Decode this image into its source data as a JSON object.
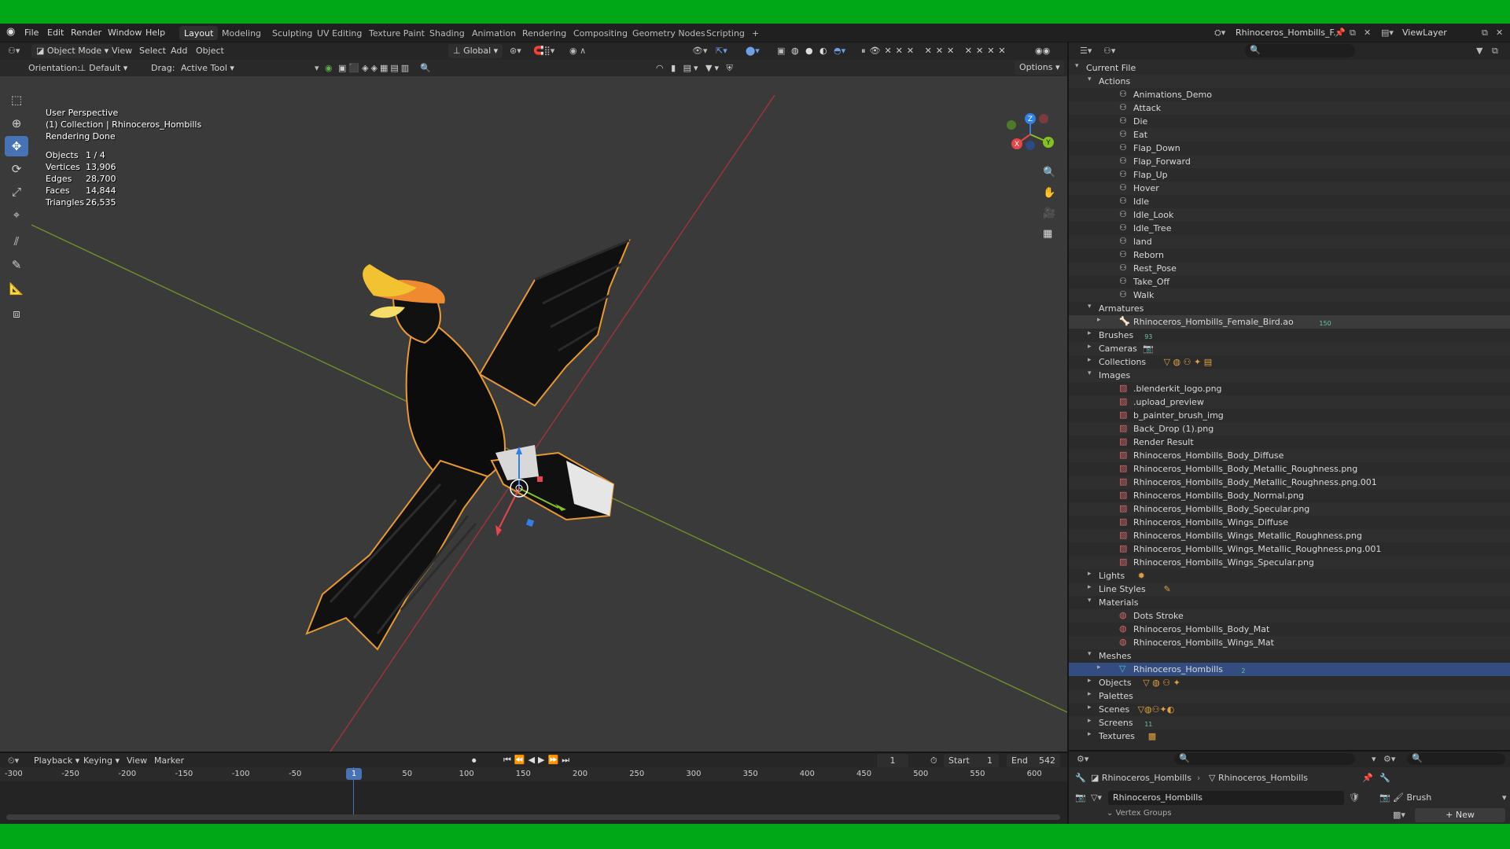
{
  "topbar": {
    "menus": [
      "File",
      "Edit",
      "Render",
      "Window",
      "Help"
    ],
    "workspaces": [
      "Layout",
      "Modeling",
      "Sculpting",
      "UV Editing",
      "Texture Paint",
      "Shading",
      "Animation",
      "Rendering",
      "Compositing",
      "Geometry Nodes",
      "Scripting"
    ],
    "active_workspace": "Layout",
    "add_workspace": "+",
    "scene_name": "Rhinoceros_Hombills_F...",
    "view_layer": "ViewLayer"
  },
  "viewport_header": {
    "mode": "Object Mode",
    "menus": [
      "View",
      "Select",
      "Add",
      "Object"
    ],
    "transform_orientation": "Global",
    "orientation_label": "Orientation:",
    "orientation_value": "Default",
    "drag_label": "Drag:",
    "drag_value": "Active Tool",
    "options": "Options"
  },
  "viewport_overlay": {
    "perspective": "User Perspective",
    "collection": "(1) Collection | Rhinoceros_Hombills",
    "status": "Rendering Done",
    "stats": [
      {
        "label": "Objects",
        "value": "1 / 4"
      },
      {
        "label": "Vertices",
        "value": "13,906"
      },
      {
        "label": "Edges",
        "value": "28,700"
      },
      {
        "label": "Faces",
        "value": "14,844"
      },
      {
        "label": "Triangles",
        "value": "26,535"
      }
    ],
    "gizmo_axes": {
      "x": "X",
      "y": "Y",
      "z": "Z"
    }
  },
  "outliner": {
    "root": "Current File",
    "actions_label": "Actions",
    "actions": [
      "Animations_Demo",
      "Attack",
      "Die",
      "Eat",
      "Flap_Down",
      "Flap_Forward",
      "Flap_Up",
      "Hover",
      "Idle",
      "Idle_Look",
      "Idle_Tree",
      "land",
      "Reborn",
      "Rest_Pose",
      "Take_Off",
      "Walk"
    ],
    "armatures_label": "Armatures",
    "armature_item": "Rhinoceros_Hombills_Female_Bird.ao",
    "armature_count": "150",
    "brushes_label": "Brushes",
    "brushes_count": "93",
    "cameras_label": "Cameras",
    "collections_label": "Collections",
    "images_label": "Images",
    "images": [
      ".blenderkit_logo.png",
      ".upload_preview",
      "b_painter_brush_img",
      "Back_Drop (1).png",
      "Render Result",
      "Rhinoceros_Hombills_Body_Diffuse",
      "Rhinoceros_Hombills_Body_Metallic_Roughness.png",
      "Rhinoceros_Hombills_Body_Metallic_Roughness.png.001",
      "Rhinoceros_Hombills_Body_Normal.png",
      "Rhinoceros_Hombills_Body_Specular.png",
      "Rhinoceros_Hombills_Wings_Diffuse",
      "Rhinoceros_Hombills_Wings_Metallic_Roughness.png",
      "Rhinoceros_Hombills_Wings_Metallic_Roughness.png.001",
      "Rhinoceros_Hombills_Wings_Specular.png"
    ],
    "lights_label": "Lights",
    "line_styles_label": "Line Styles",
    "materials_label": "Materials",
    "materials": [
      "Dots Stroke",
      "Rhinoceros_Hombills_Body_Mat",
      "Rhinoceros_Hombills_Wings_Mat"
    ],
    "meshes_label": "Meshes",
    "mesh_item": "Rhinoceros_Hombills",
    "mesh_count": "2",
    "objects_label": "Objects",
    "palettes_label": "Palettes",
    "scenes_label": "Scenes",
    "screens_label": "Screens",
    "screens_count": "11",
    "textures_label": "Textures"
  },
  "timeline": {
    "menus": [
      "Playback",
      "Keying",
      "View",
      "Marker"
    ],
    "current_frame": "1",
    "start_label": "Start",
    "start": "1",
    "end_label": "End",
    "end": "542",
    "ticks": [
      "-300",
      "-250",
      "-200",
      "-150",
      "-100",
      "-50",
      "1",
      "50",
      "100",
      "150",
      "200",
      "250",
      "300",
      "350",
      "400",
      "450",
      "500",
      "550",
      "600"
    ]
  },
  "properties": {
    "breadcrumb_object": "Rhinoceros_Hombills",
    "breadcrumb_mesh": "Rhinoceros_Hombills",
    "mesh_name": "Rhinoceros_Hombills",
    "brush_name": "Brush",
    "new_button": "New",
    "vertex_groups": "Vertex Groups"
  },
  "colors": {
    "accent": "#4772b3",
    "selected_row": "#334d80",
    "x_axis": "#e8444c",
    "y_axis": "#84c224",
    "z_axis": "#2f80e8",
    "selection_outline": "#f0a030",
    "green_screen": "#00a818"
  }
}
